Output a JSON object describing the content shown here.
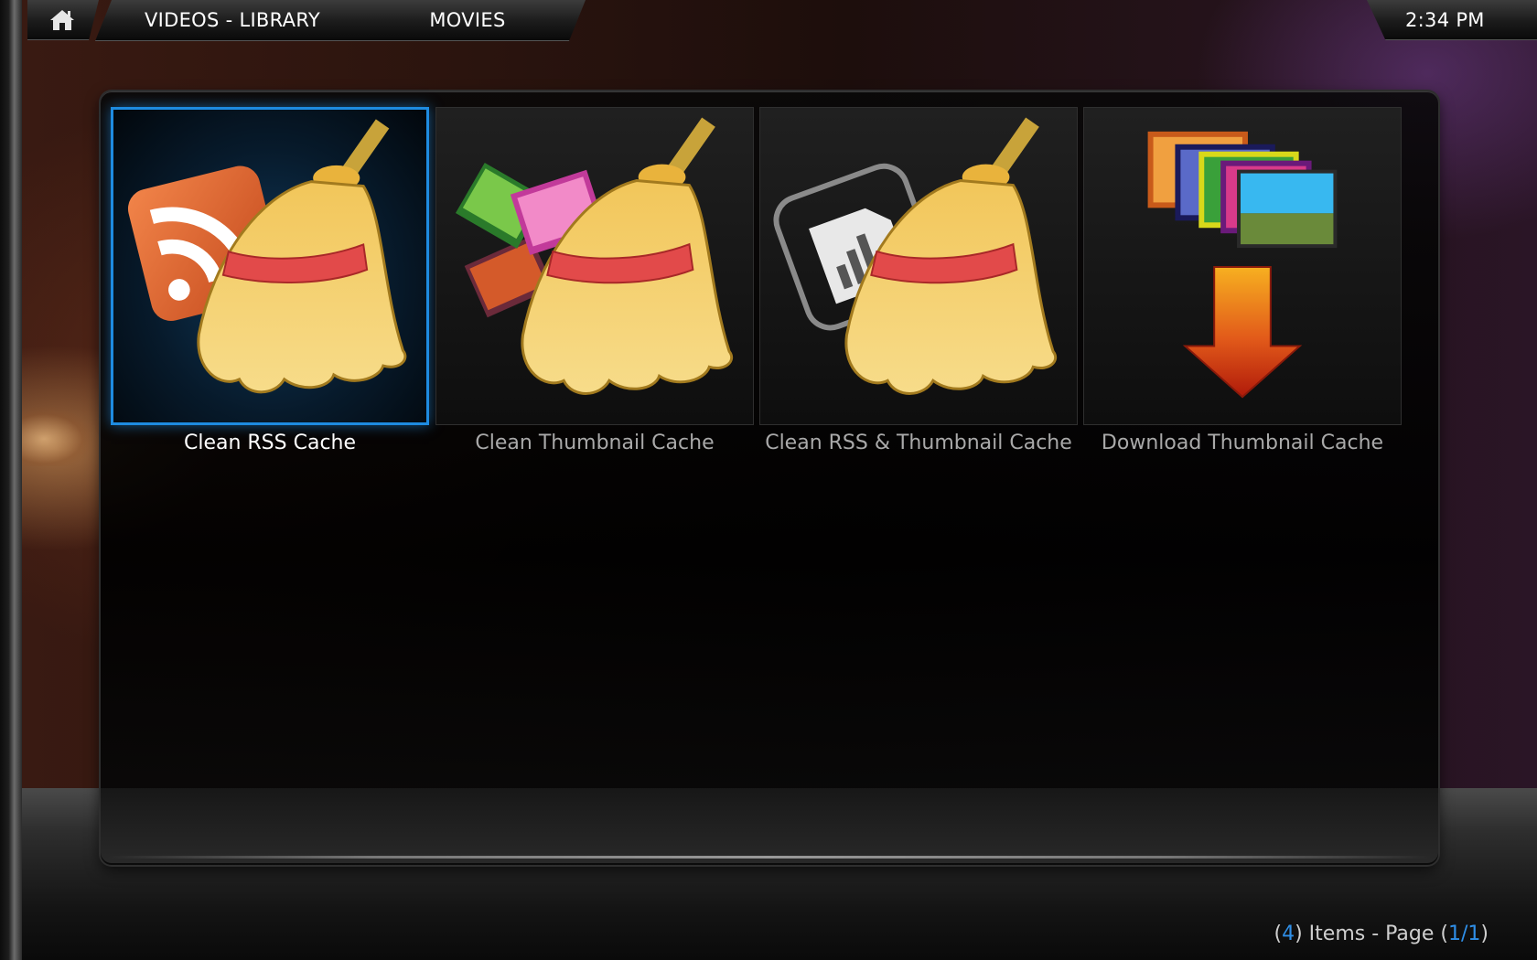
{
  "topbar": {
    "home_icon": "home-icon",
    "section": "VIDEOS - LIBRARY",
    "subsection": "MOVIES",
    "clock": "2:34 PM"
  },
  "items": [
    {
      "label": "Clean RSS Cache",
      "icon": "broom-rss-icon",
      "focused": true
    },
    {
      "label": "Clean Thumbnail Cache",
      "icon": "broom-thumbnails-icon",
      "focused": false
    },
    {
      "label": "Clean RSS & Thumbnail Cache",
      "icon": "broom-rss-thumbnails-icon",
      "focused": false
    },
    {
      "label": "Download Thumbnail Cache",
      "icon": "download-thumbnails-icon",
      "focused": false
    }
  ],
  "footer": {
    "open_paren": "(",
    "item_count": "4",
    "items_text": ") Items - Page (",
    "page": "1/1",
    "close_paren": ")"
  },
  "colors": {
    "focus": "#1e8be0",
    "accent_text": "#2f8fe8"
  }
}
